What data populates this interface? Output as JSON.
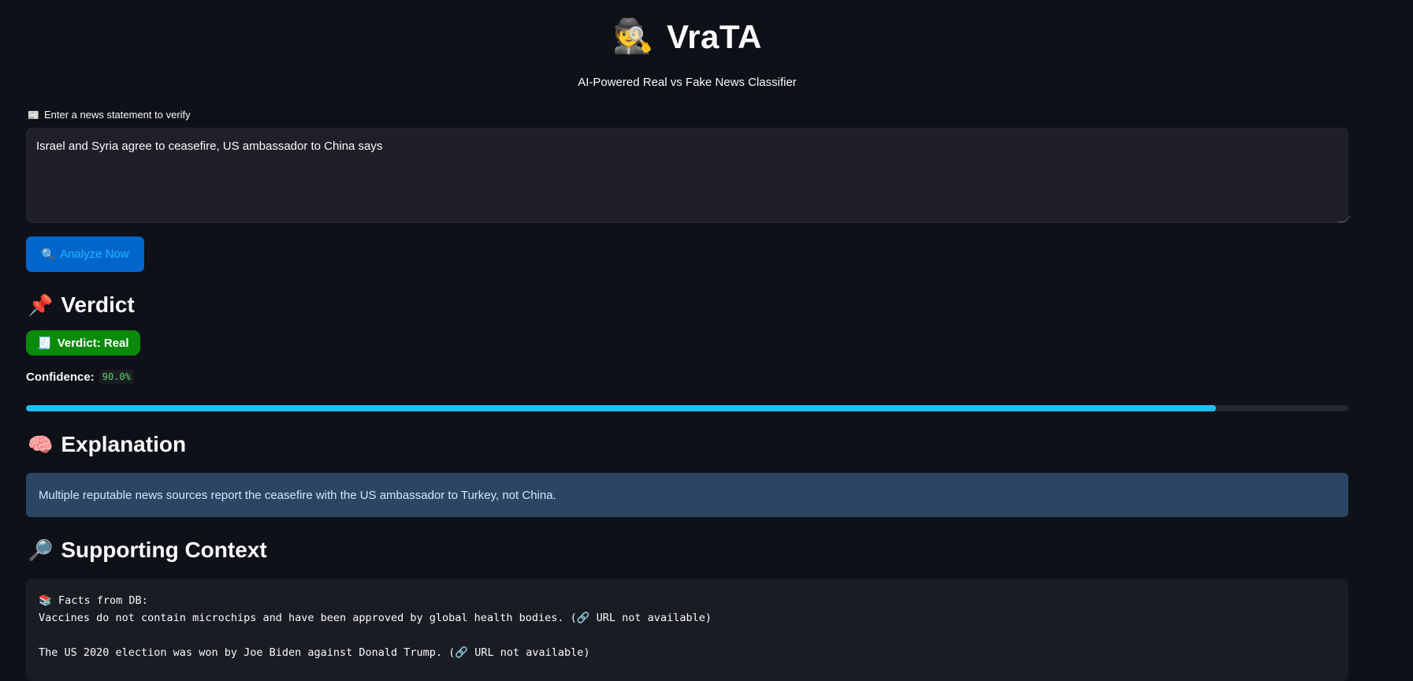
{
  "header": {
    "title_emoji": "🕵️",
    "title": "VraTA",
    "subtitle": "AI-Powered Real vs Fake News Classifier"
  },
  "input": {
    "label_icon": "📰",
    "label": "Enter a news statement to verify",
    "value": "Israel and Syria agree to ceasefire, US ambassador to China says"
  },
  "analyze_button": {
    "icon": "🔍",
    "label": "Analyze Now"
  },
  "verdict": {
    "heading_emoji": "📌",
    "heading": "Verdict",
    "badge_icon": "🧾",
    "badge_text": "Verdict: Real",
    "badge_color": "#0a8a0a",
    "confidence_label": "Confidence:",
    "confidence_value": "90.0%",
    "confidence_fraction": 0.9
  },
  "explanation": {
    "heading_emoji": "🧠",
    "heading": "Explanation",
    "text": "Multiple reputable news sources report the ceasefire with the US ambassador to Turkey, not China."
  },
  "context": {
    "heading_emoji": "🔎",
    "heading": "Supporting Context",
    "body": "📚 Facts from DB:\nVaccines do not contain microchips and have been approved by global health bodies. (🔗 URL not available)\n\nThe US 2020 election was won by Joe Biden against Donald Trump. (🔗 URL not available)"
  },
  "colors": {
    "background": "#0e1117",
    "accent_button": "#0066cc",
    "progress": "#1fbef5",
    "info_box": "#2c4562"
  }
}
